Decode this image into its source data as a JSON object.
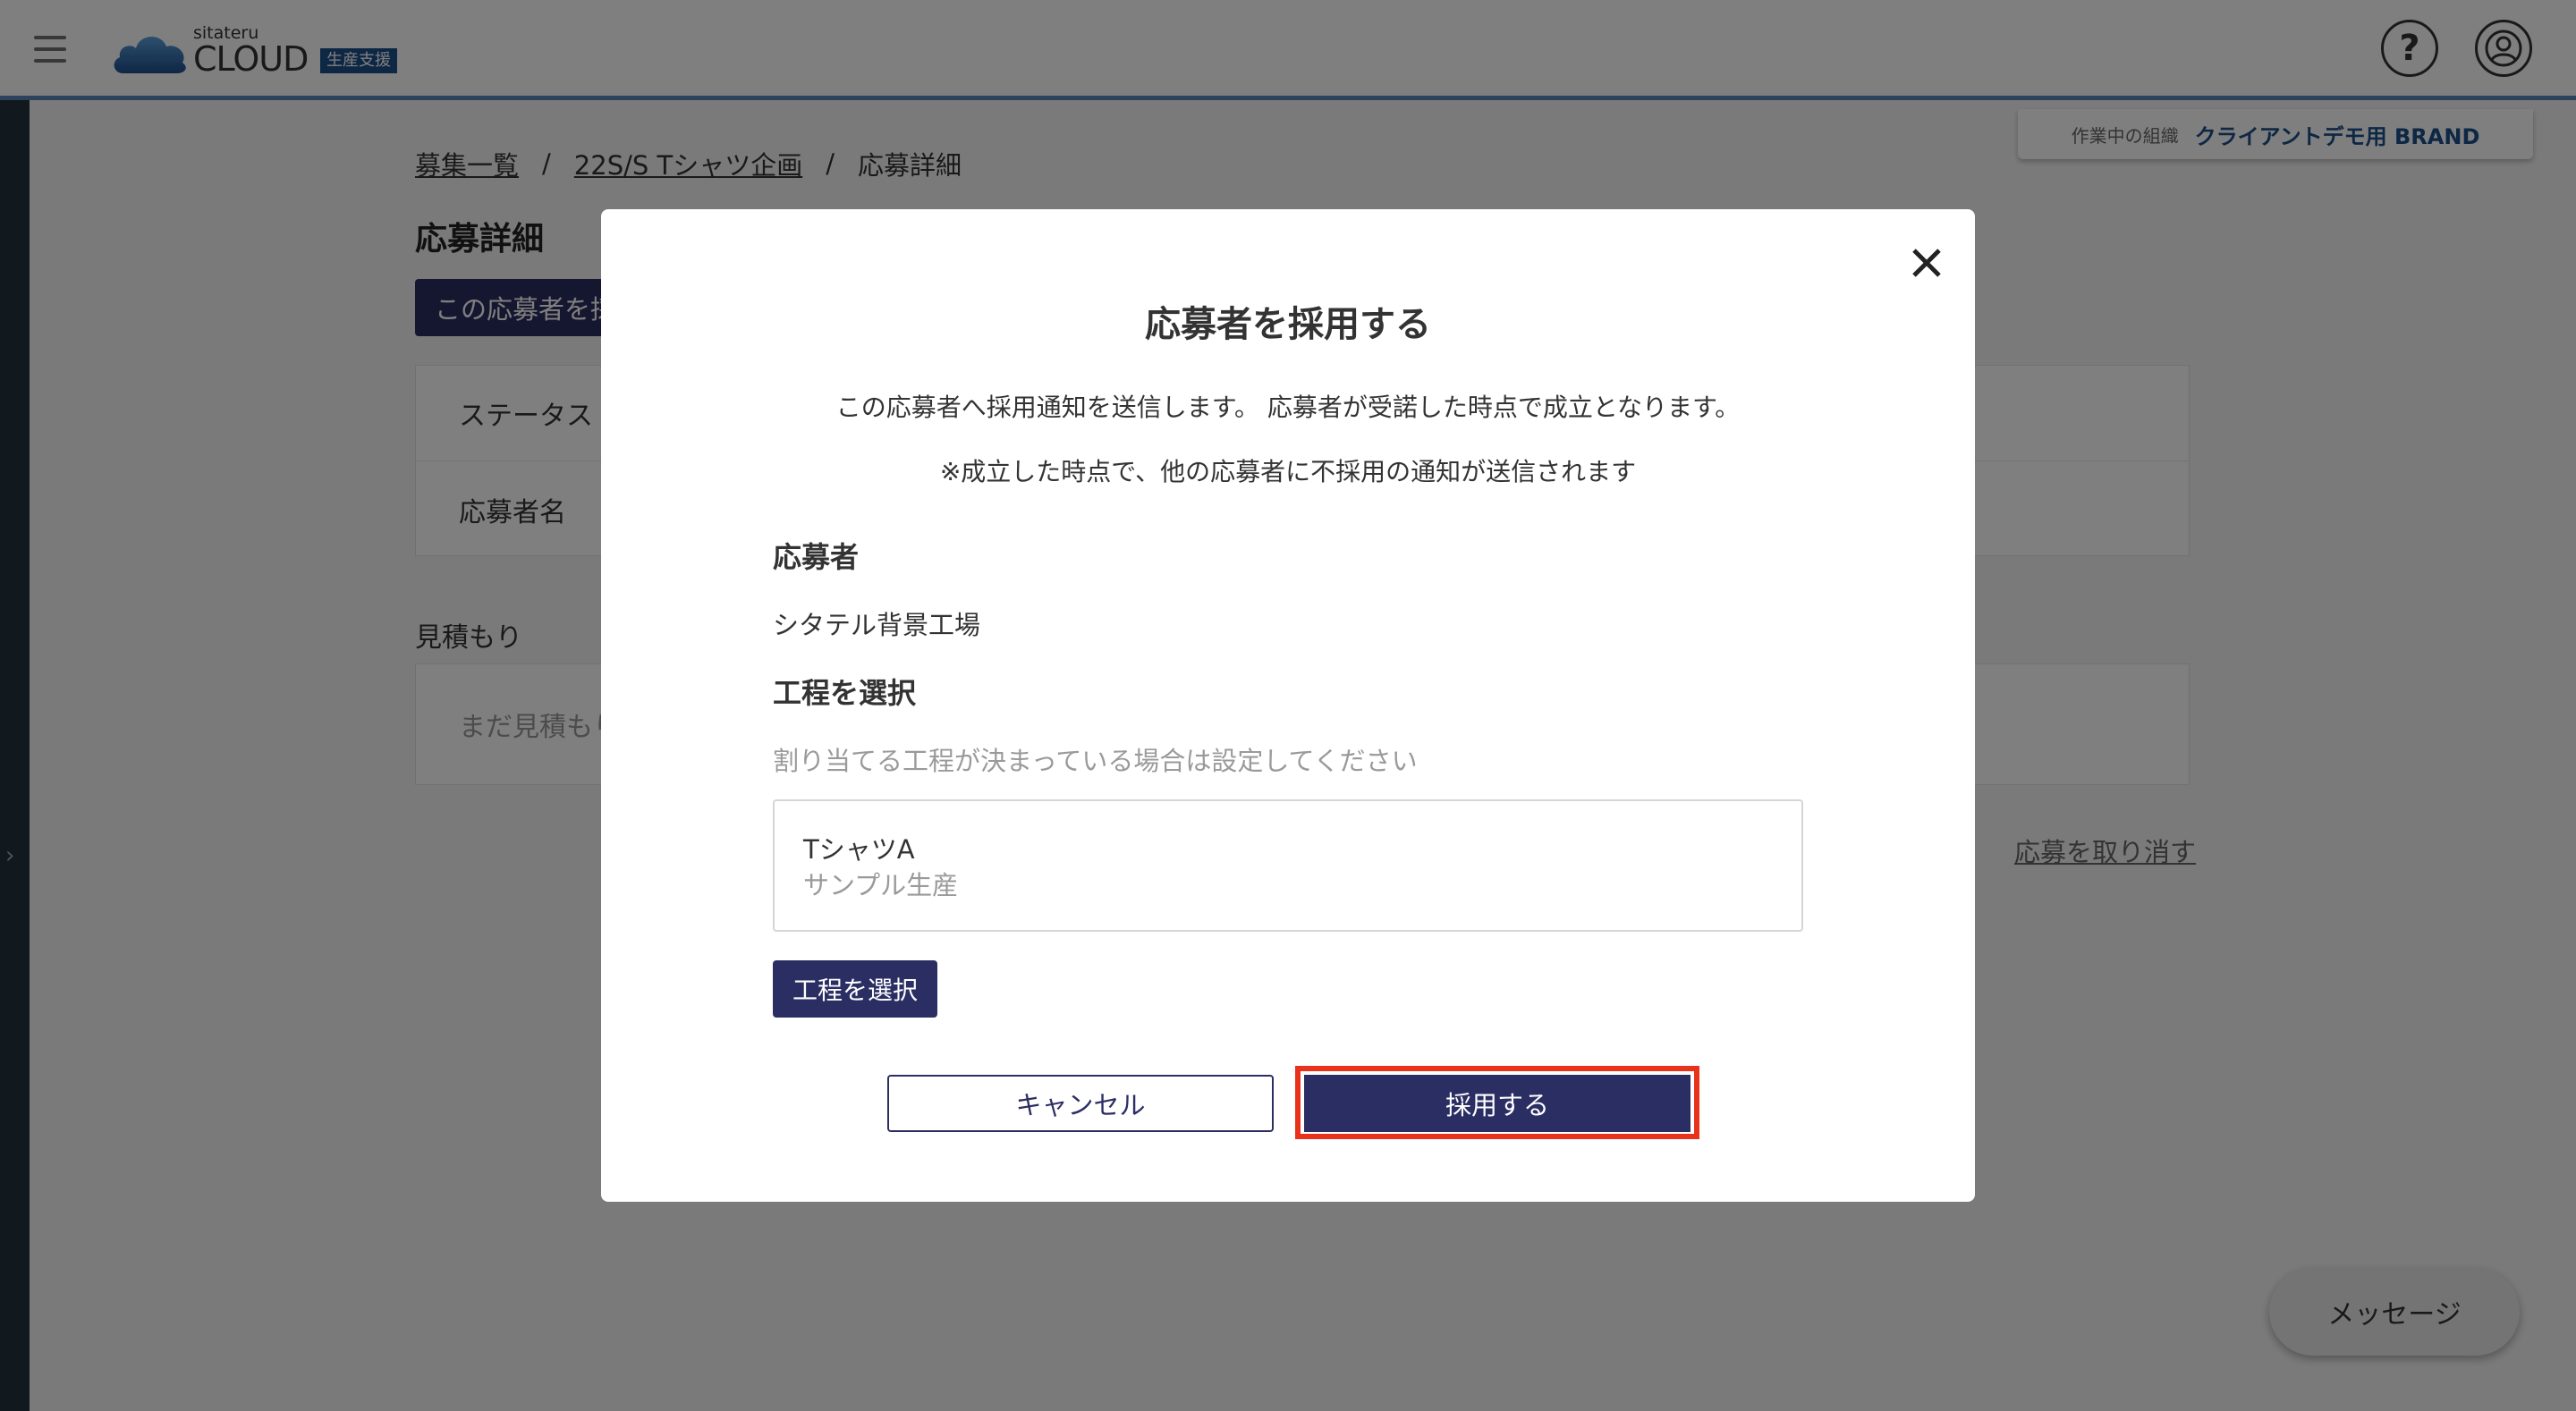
{
  "header": {
    "logo_small": "sitateru",
    "logo_main": "CLOUD",
    "logo_tag": "生産支援",
    "help_symbol": "?",
    "org_label": "作業中の組織",
    "org_name": "クライアントデモ用 BRAND"
  },
  "breadcrumb": {
    "items": [
      "募集一覧",
      "22S/S Tシャツ企画",
      "応募詳細"
    ],
    "separator": "/"
  },
  "page": {
    "title": "応募詳細",
    "adopt_button": "この応募者を採用する",
    "rows": [
      "ステータス",
      "応募者名"
    ],
    "quote_label": "見積もり",
    "quote_empty": "まだ見積もりはありません",
    "cancel_application": "応募を取り消す",
    "message_button": "メッセージ"
  },
  "modal": {
    "title": "応募者を採用する",
    "description": "この応募者へ採用通知を送信します。 応募者が受諾した時点で成立となります。",
    "note": "※成立した時点で、他の応募者に不採用の通知が送信されます",
    "applicant_label": "応募者",
    "applicant_name": "シタテル背景工場",
    "process_label": "工程を選択",
    "process_hint": "割り当てる工程が決まっている場合は設定してください",
    "process_name": "TシャツA",
    "process_sub": "サンプル生産",
    "select_process_button": "工程を選択",
    "cancel_button": "キャンセル",
    "adopt_button": "採用する"
  },
  "colors": {
    "primary": "#2b2e63",
    "brand_blue": "#1b4e89",
    "highlight": "#e8321c",
    "header_border": "#5b87bb"
  },
  "icons": [
    "hamburger-icon",
    "cloud-logo-icon",
    "help-icon",
    "user-icon",
    "chevron-right-icon",
    "close-icon"
  ]
}
